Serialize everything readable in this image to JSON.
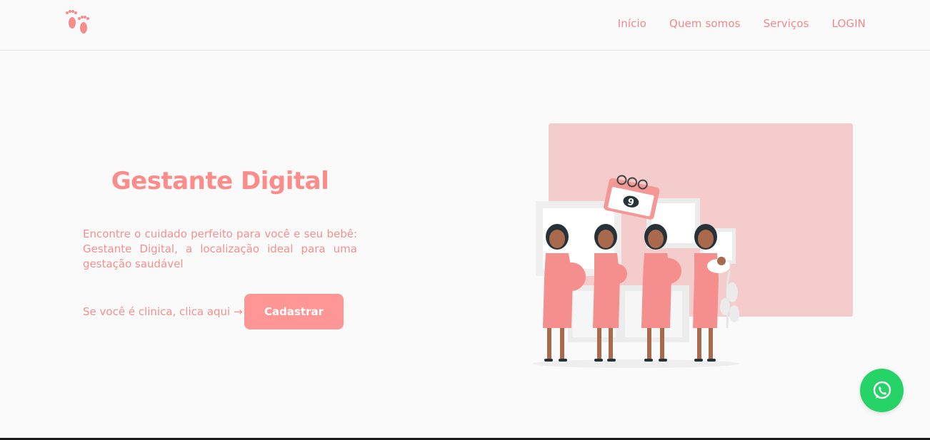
{
  "header": {
    "logo_icon": "baby-feet-icon",
    "nav": [
      {
        "label": "Início"
      },
      {
        "label": "Quem somos"
      },
      {
        "label": "Serviços"
      },
      {
        "label": "LOGIN"
      }
    ]
  },
  "hero": {
    "title": "Gestante Digital",
    "description": "Encontre o cuidado perfeito para você e seu bebê: Gestante Digital, a localização ideal para uma gestação saudável",
    "cta_text": "Se você é clinica, clica aqui →",
    "cta_button": "Cadastrar",
    "illustration": {
      "icon": "pregnant-women-illustration",
      "calendar_number": "9"
    }
  },
  "floating": {
    "whatsapp_icon": "whatsapp-icon"
  },
  "colors": {
    "accent": "#fb8c8a",
    "button": "#fd9694",
    "panel": "#f4cccb",
    "whatsapp": "#25d366"
  }
}
